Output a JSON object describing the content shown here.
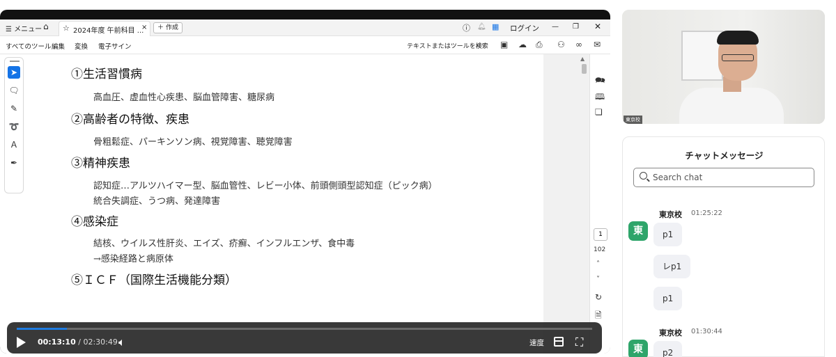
{
  "acrobat": {
    "menu_label": "メニュー",
    "tab_title": "2024年度 午前科目 ...",
    "create_label": "作成",
    "login_label": "ログイン",
    "toolbar": {
      "all_tools": "すべてのツール",
      "edit": "編集",
      "convert": "変換",
      "esign": "電子サイン",
      "search_placeholder": "テキストまたはツールを検索"
    },
    "page_current": "1",
    "page_total": "102"
  },
  "document": {
    "sections": [
      {
        "heading": "①生活習慣病",
        "lines": [
          "高血圧、虚血性心疾患、脳血管障害、糖尿病"
        ]
      },
      {
        "heading": "②高齢者の特徴、疾患",
        "lines": [
          "骨粗鬆症、パーキンソン病、視覚障害、聴覚障害"
        ]
      },
      {
        "heading": "③精神疾患",
        "lines": [
          "認知症…アルツハイマー型、脳血管性、レビー小体、前頭側頭型認知症（ピック病）",
          "統合失調症、うつ病、発達障害"
        ]
      },
      {
        "heading": "④感染症",
        "lines": [
          "結核、ウイルス性肝炎、エイズ、疥癬、インフルエンザ、食中毒",
          "→感染経路と病原体"
        ]
      },
      {
        "heading": "⑤ＩＣＦ（国際生活機能分類）",
        "lines": []
      }
    ]
  },
  "player": {
    "current_time": "00:13:10",
    "separator": "/",
    "total_time": "02:30:49",
    "progress_fraction": 0.087,
    "speed_label": "速度"
  },
  "webcam": {
    "label": "東京校"
  },
  "chat": {
    "title": "チャットメッセージ",
    "search_placeholder": "Search chat",
    "groups": [
      {
        "avatar": "東",
        "sender": "東京校",
        "time": "01:25:22",
        "messages": [
          "p1",
          "レp1",
          "p1"
        ]
      },
      {
        "avatar": "東",
        "sender": "東京校",
        "time": "01:30:44",
        "messages": [
          "p2"
        ]
      }
    ]
  },
  "colors": {
    "accent": "#1473e6",
    "progress": "#1e7be0",
    "avatar": "#2ea56a"
  }
}
